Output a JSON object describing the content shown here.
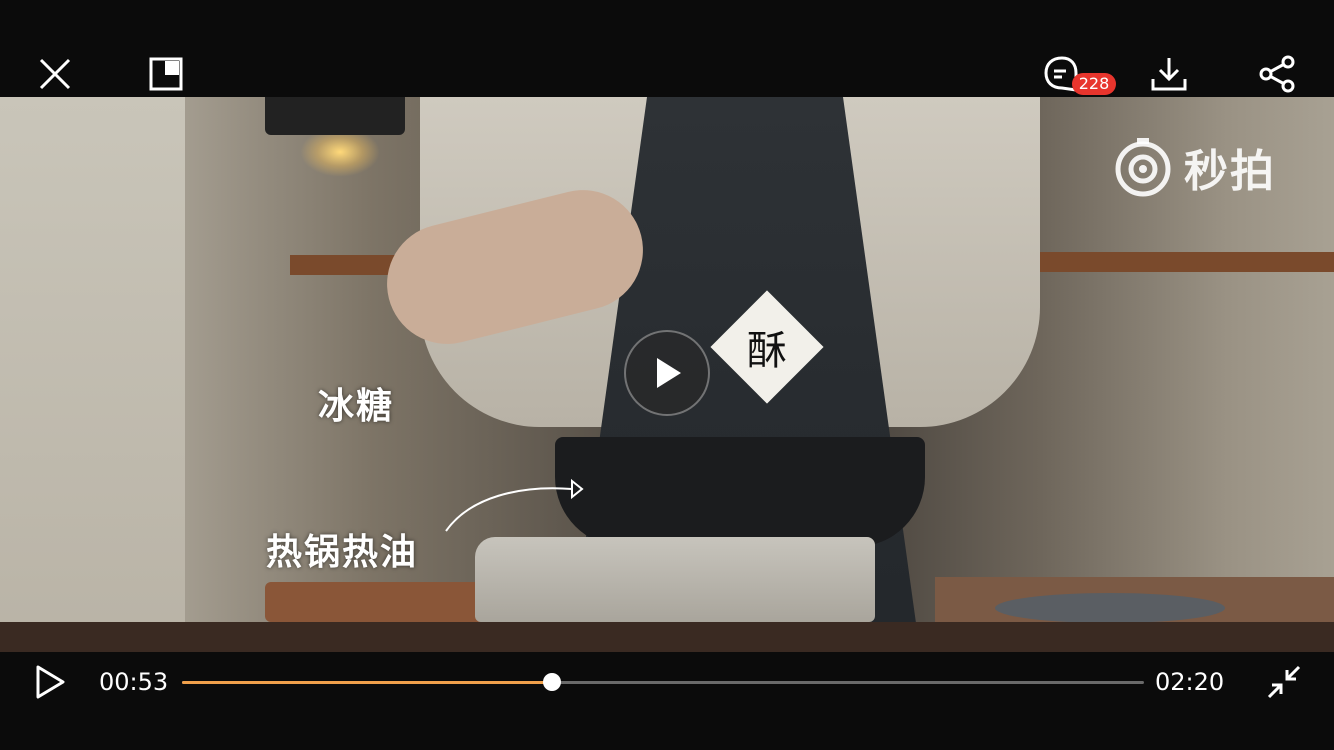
{
  "top_bar": {
    "close_icon": "close-icon",
    "pip_icon": "picture-in-picture-icon",
    "comment_icon": "comment-icon",
    "comment_count": "228",
    "download_icon": "download-icon",
    "share_icon": "share-icon",
    "badge_color": "#e8352d"
  },
  "video": {
    "watermark_text": "秒拍",
    "sticker_text": "酥",
    "caption_top": "冰糖",
    "caption_bottom": "热锅热油",
    "center_play_icon": "play-icon"
  },
  "controls": {
    "play_icon": "play-icon",
    "current_time": "00:53",
    "total_time": "02:20",
    "progress_fraction": 0.385,
    "progress_color": "#f0a04b",
    "exit_fullscreen_icon": "exit-fullscreen-icon"
  }
}
